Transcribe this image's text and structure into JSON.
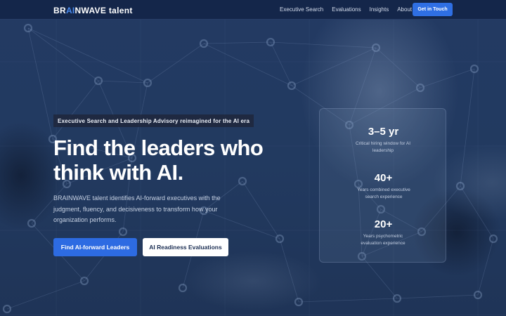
{
  "brand": {
    "logo_prefix": "BR",
    "logo_ai": "AI",
    "logo_suffix": "NWAVE",
    "logo_talent": "talent"
  },
  "nav": {
    "links": [
      "Executive Search",
      "Evaluations",
      "Insights",
      "About"
    ],
    "cta": "Get in Touch"
  },
  "hero": {
    "tagline": "Executive Search and Leadership Advisory reimagined for the AI era",
    "headline_line1": "Find the leaders who",
    "headline_line2": "think with AI.",
    "subcopy": "BRAINWAVE talent identifies AI-forward executives with the judgment, fluency, and decisiveness to transform how your organization performs.",
    "primary_button": "Find AI-forward Leaders",
    "secondary_button": "AI Readiness Evaluations"
  },
  "stats": [
    {
      "value": "3–5 yr",
      "label": "Critical hiring window for AI leadership"
    },
    {
      "value": "40+",
      "label": "Years combined executive search experience"
    },
    {
      "value": "20+",
      "label": "Years psychometric evaluation experience"
    }
  ],
  "colors": {
    "accent": "#2f6fe4",
    "nav_bg": "#14264a",
    "hero_bg": "#223a60",
    "logo_ai": "#4a8cf0"
  }
}
